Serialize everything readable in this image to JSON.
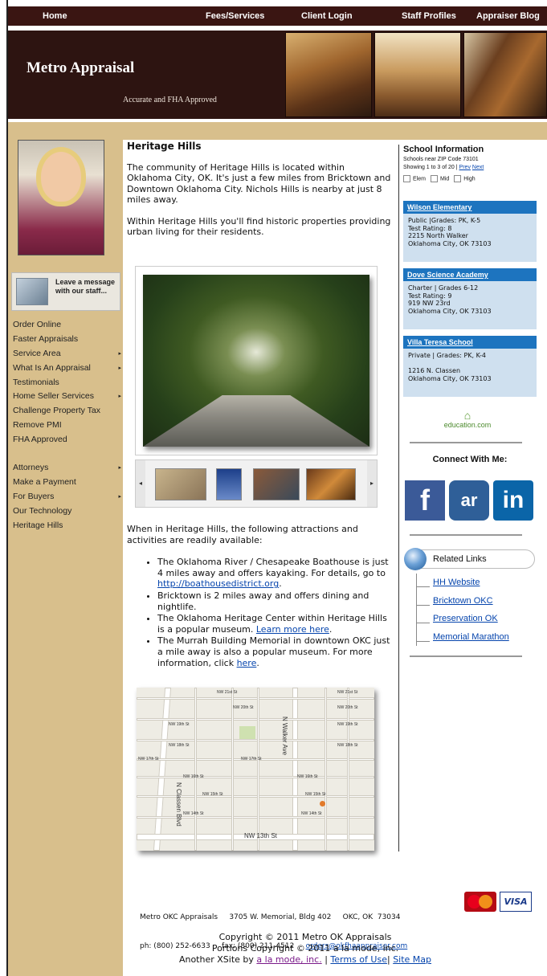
{
  "nav": {
    "items": [
      "Home",
      "Fees/Services",
      "Client Login",
      "Staff Profiles",
      "Appraiser Blog"
    ]
  },
  "header": {
    "brand": "Metro Appraisal",
    "tagline": "Accurate and FHA Approved"
  },
  "sidebar": {
    "leave_message": "Leave a message with our staff...",
    "menu": [
      {
        "label": "Order Online",
        "arrow": false
      },
      {
        "label": "Faster Appraisals",
        "arrow": false
      },
      {
        "label": "Service Area",
        "arrow": true
      },
      {
        "label": "What Is An Appraisal",
        "arrow": true
      },
      {
        "label": "Testimonials",
        "arrow": false
      },
      {
        "label": "Home Seller Services",
        "arrow": true
      },
      {
        "label": "Challenge Property Tax",
        "arrow": false
      },
      {
        "label": "Remove PMI",
        "arrow": false
      },
      {
        "label": "FHA Approved",
        "arrow": false
      }
    ],
    "menu2": [
      {
        "label": "Attorneys",
        "arrow": true
      },
      {
        "label": "Make a Payment",
        "arrow": false
      },
      {
        "label": "For Buyers",
        "arrow": true
      },
      {
        "label": "Our Technology",
        "arrow": false
      },
      {
        "label": "Heritage Hills",
        "arrow": false
      }
    ],
    "arrow_glyph": "▸"
  },
  "main": {
    "title": "Heritage Hills",
    "p1": "The community of Heritage Hills is located within Oklahoma City, OK. It's just a few miles from Bricktown and Downtown Oklahoma City. Nichols Hills is nearby at just 8 miles away.",
    "p2": "Within Heritage Hills you'll find historic properties providing urban living for their residents.",
    "attractions_intro": "When in Heritage Hills, the following attractions and activities are readily available:",
    "bullets": {
      "b1_pre": "The Oklahoma River / Chesapeake Boathouse is just 4 miles away and offers kayaking. For details, go to ",
      "b1_link": "http://boathousedistrict.org",
      "b1_post": ".",
      "b2": "Bricktown is 2 miles away and offers dining and nightlife.",
      "b3_pre": "The Oklahoma Heritage Center within Heritage Hills is a popular museum. ",
      "b3_link": "Learn more here",
      "b3_post": ".",
      "b4_pre": "The Murrah Building Memorial in downtown OKC just a mile away is also a popular museum. For more information, click ",
      "b4_link": "here",
      "b4_post": "."
    },
    "gallery": {
      "prev": "◂",
      "next": "▸"
    }
  },
  "map": {
    "labels": [
      "NW 21st St",
      "NW 20th St",
      "NW 19th St",
      "NW 18th St",
      "NW 17th St",
      "NW 16th St",
      "NW 15th St",
      "NW 14th St",
      "NW 13th St",
      "N Walker Ave",
      "N Classen Blvd"
    ]
  },
  "schools": {
    "title": "School Information",
    "subtitle": "Schools near ZIP Code 73101",
    "showing": "Showing 1 to 3 of 20 |",
    "prev": "Prev",
    "next": "Next",
    "filters": [
      "Elem",
      "Mid",
      "High"
    ],
    "list": [
      {
        "name": "Wilson Elementary",
        "l1": "Public  |Grades: PK, K-5",
        "l2": "Test Rating: 8",
        "l3": "2215 North Walker",
        "l4": "Oklahoma City, OK 73103"
      },
      {
        "name": "Dove Science Academy",
        "l1": "Charter | Grades 6-12",
        "l2": "Test Rating: 9",
        "l3": "919 NW 23rd",
        "l4": "Oklahoma City, OK 73103"
      },
      {
        "name": "Villa Teresa School",
        "l1": "Private | Grades: PK, K-4",
        "l2": "",
        "l3": "1216 N. Classen",
        "l4": "Oklahoma City, OK 73103"
      }
    ],
    "education": "education.com"
  },
  "social": {
    "title": "Connect With Me:",
    "facebook": "f",
    "activerain": "ar",
    "linkedin": "in",
    "colors": {
      "facebook": "#3b5a98",
      "activerain": "#2f5f98",
      "linkedin": "#0b65a8"
    }
  },
  "related": {
    "title": "Related Links",
    "links": [
      "HH Website",
      "Bricktown OKC",
      "Preservation OK",
      "Memorial Marathon"
    ]
  },
  "footer": {
    "address": "Metro OKC Appraisals     3705 W. Memorial, Bldg 402     OKC, OK  73034",
    "phones": "ph: (800) 252-6633     fax: (800) 211-4512     ",
    "email": "orders@okfhaappraiser.com",
    "copyright1": "Copyright © 2011 Metro OK Appraisals",
    "copyright2": "Portions Copyright © 2011 a la mode, inc.",
    "xsite_pre": "Another XSite by ",
    "alamode": "a la mode, inc.",
    "terms": "Terms of Use",
    "sitemap": "Site Map",
    "visa": "VISA",
    "mastercard": "MasterCard"
  }
}
